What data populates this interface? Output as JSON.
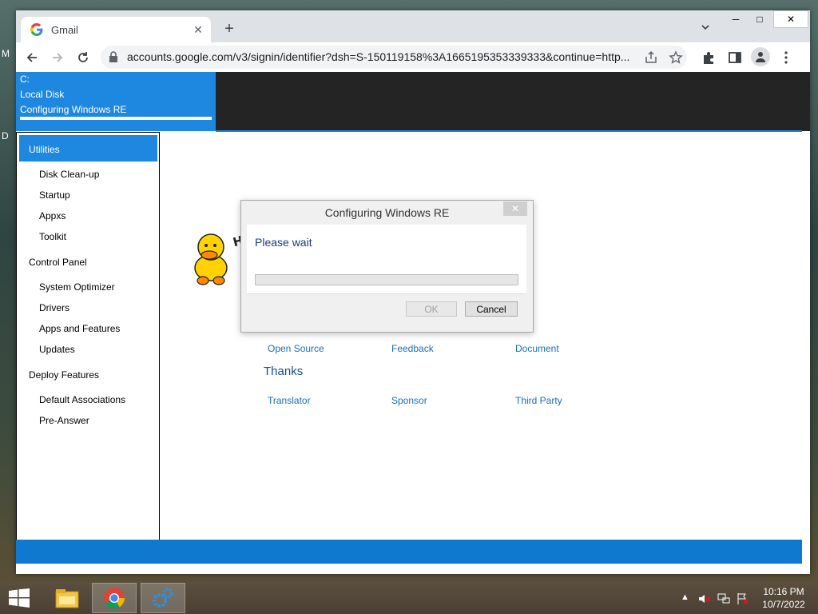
{
  "desktop": {
    "left_letters": [
      "M",
      "D"
    ]
  },
  "browser": {
    "tab": {
      "title": "Gmail",
      "favicon": "google-g-icon"
    },
    "new_tab": "+",
    "url": "accounts.google.com/v3/signin/identifier?dsh=S-150119158%3A1665195353339333&continue=http...",
    "window_controls": {
      "minimize": "─",
      "maximize": "□",
      "close": "✕"
    }
  },
  "app": {
    "drive": {
      "letter": "C:",
      "name": "Local Disk",
      "status": "Configuring Windows RE"
    },
    "sidebar": [
      {
        "label": "Utilities",
        "type": "head",
        "selected": true
      },
      {
        "label": "Disk Clean-up",
        "type": "sub"
      },
      {
        "label": "Startup",
        "type": "sub"
      },
      {
        "label": "Appxs",
        "type": "sub"
      },
      {
        "label": "Toolkit",
        "type": "sub"
      },
      {
        "label": "Control Panel",
        "type": "head"
      },
      {
        "label": "System Optimizer",
        "type": "sub"
      },
      {
        "label": "Drivers",
        "type": "sub"
      },
      {
        "label": "Apps and Features",
        "type": "sub"
      },
      {
        "label": "Updates",
        "type": "sub"
      },
      {
        "label": "Deploy Features",
        "type": "head"
      },
      {
        "label": "Default Associations",
        "type": "sub"
      },
      {
        "label": "Pre-Answer",
        "type": "sub"
      }
    ],
    "mascot_text": "Hi~",
    "links_row1": [
      "Open Source",
      "Feedback",
      "Document"
    ],
    "thanks_heading": "Thanks",
    "links_row2": [
      "Translator",
      "Sponsor",
      "Third Party"
    ]
  },
  "dialog": {
    "title": "Configuring Windows RE",
    "close": "✕",
    "message": "Please wait",
    "progress": 0,
    "ok_label": "OK",
    "cancel_label": "Cancel"
  },
  "taskbar": {
    "time": "10:16 PM",
    "date": "10/7/2022",
    "apps": [
      "file-explorer-icon",
      "chrome-icon",
      "settings-gears-icon"
    ]
  },
  "colors": {
    "accent": "#1e88e0",
    "footer": "#0f78cf",
    "link": "#1a6eb8"
  }
}
